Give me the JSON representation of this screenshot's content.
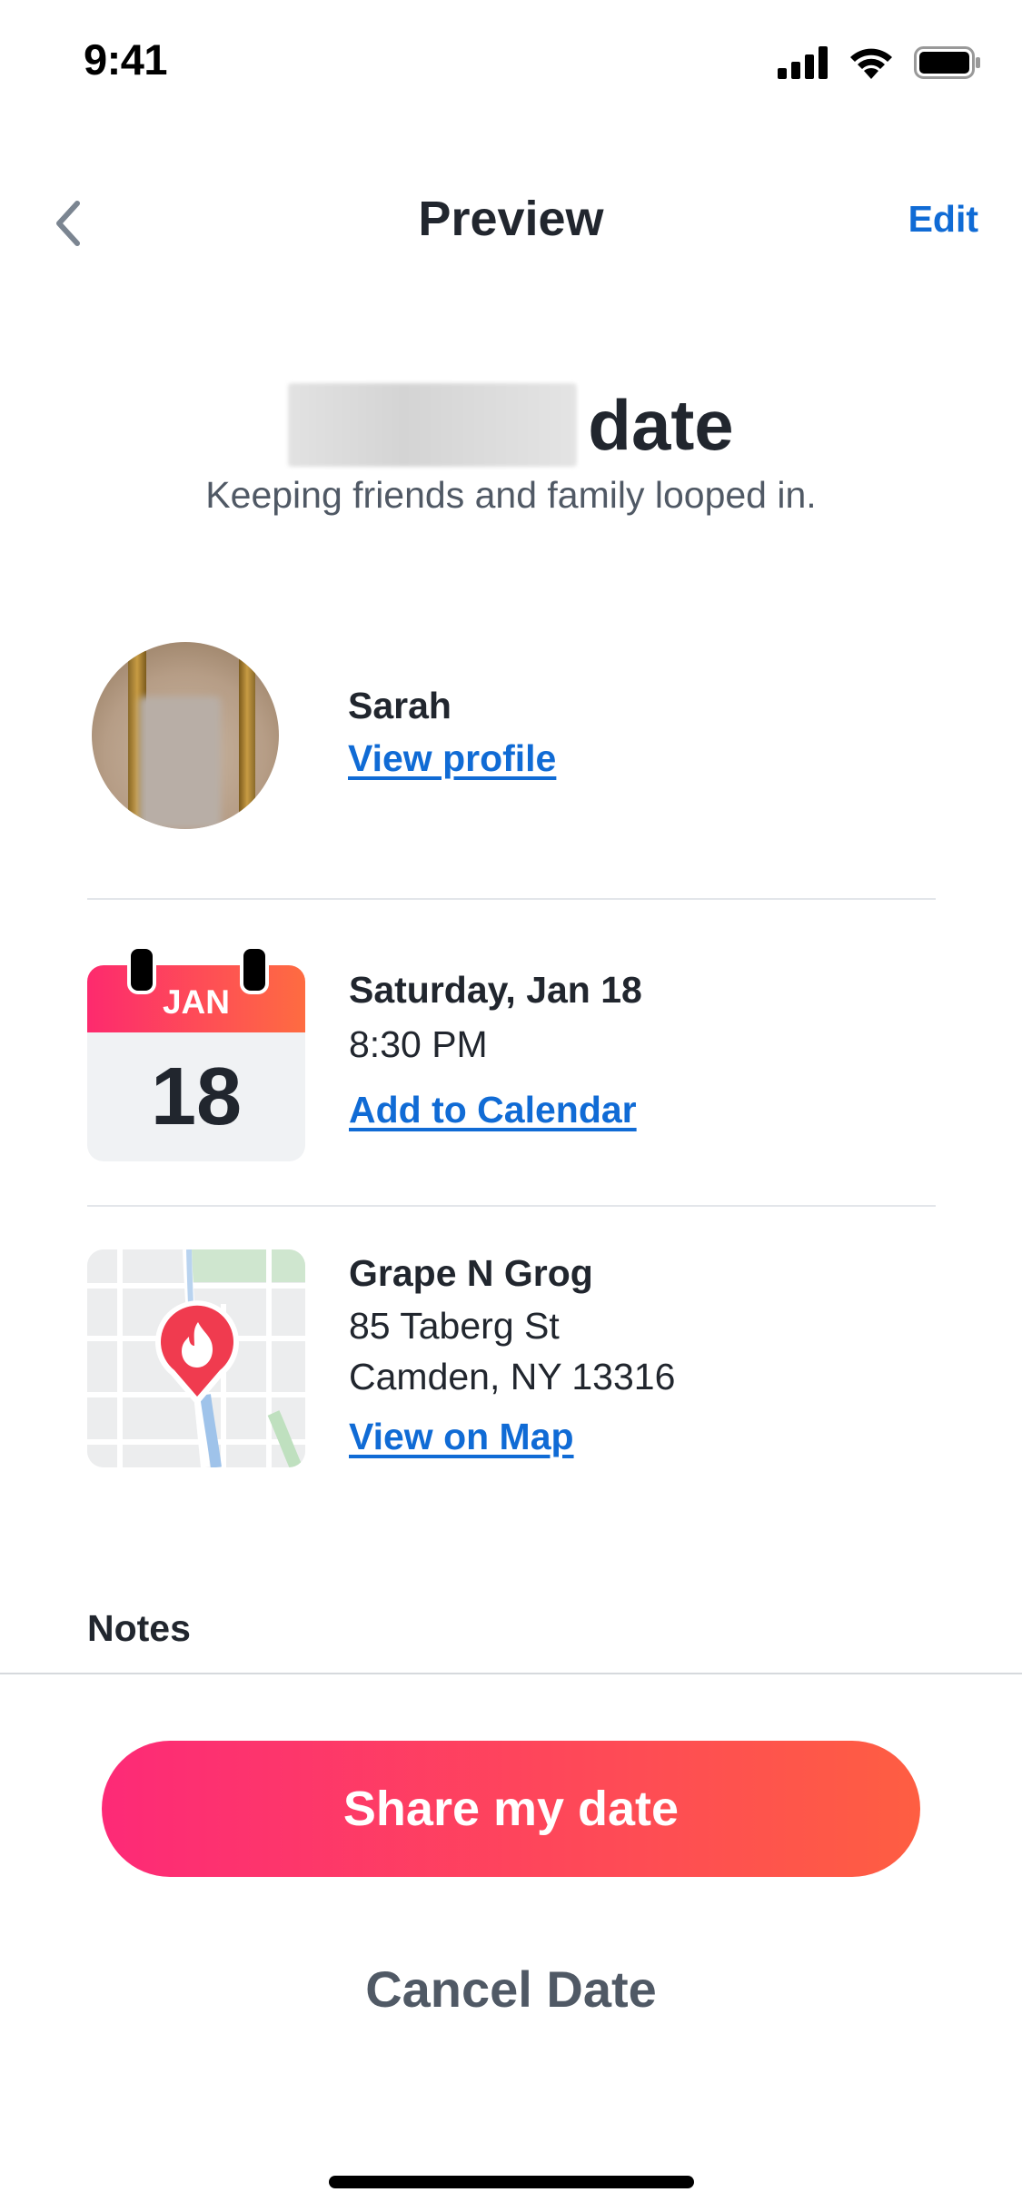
{
  "status_bar": {
    "time": "9:41",
    "icons": [
      "cellular-signal-icon",
      "wifi-icon",
      "battery-icon"
    ]
  },
  "nav": {
    "back_icon": "chevron-left-icon",
    "title": "Preview",
    "edit_label": "Edit"
  },
  "header": {
    "title_suffix": "date",
    "subtitle": "Keeping friends and family looped in."
  },
  "match": {
    "name": "Sarah",
    "link": "View profile"
  },
  "schedule": {
    "calendar_month": "JAN",
    "calendar_day": "18",
    "date": "Saturday, Jan 18",
    "time": "8:30 PM",
    "link": "Add to Calendar"
  },
  "location": {
    "venue": "Grape N Grog",
    "address_line1": "85 Taberg St",
    "address_line2": "Camden, NY 13316",
    "link": "View on Map",
    "pin_icon": "map-pin-flame-icon"
  },
  "notes": {
    "label": "Notes"
  },
  "actions": {
    "share_label": "Share my date",
    "cancel_label": "Cancel Date"
  },
  "colors": {
    "link_blue": "#106bd5",
    "brand_gradient_start": "#fd2a77",
    "brand_gradient_end": "#fe5e42",
    "text_dark": "#21262e",
    "text_secondary": "#505965"
  }
}
